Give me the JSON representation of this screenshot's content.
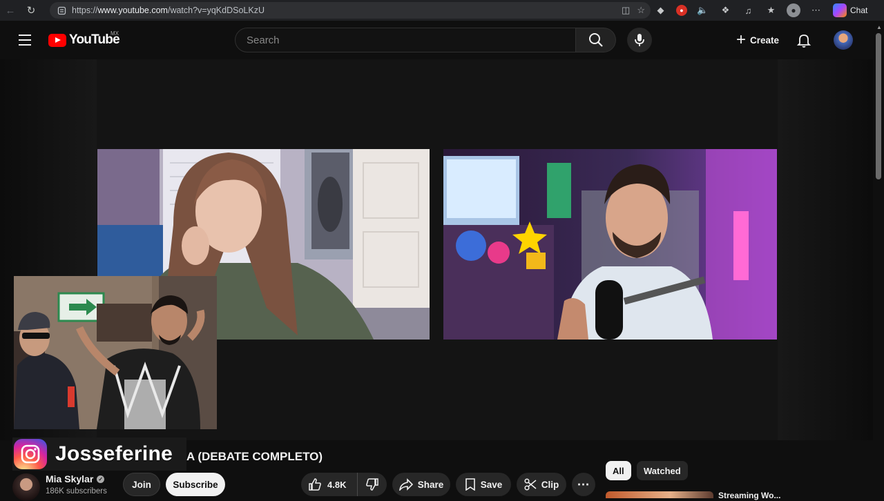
{
  "browser": {
    "url_prefix": "https://",
    "url_domain": "www.youtube.com",
    "url_path": "/watch?v=yqKdDSoLKzU",
    "chat_label": "Chat"
  },
  "header": {
    "logo_text": "YouTube",
    "region": "MX",
    "search_placeholder": "Search",
    "create_label": "Create"
  },
  "video": {
    "title_visible": "A (DEBATE COMPLETO)",
    "overlay_handle": "Josseferine"
  },
  "channel": {
    "name": "Mia Skylar",
    "subscribers": "186K subscribers",
    "join_label": "Join",
    "subscribe_label": "Subscribe"
  },
  "actions": {
    "likes": "4.8K",
    "share_label": "Share",
    "save_label": "Save",
    "clip_label": "Clip"
  },
  "chips": {
    "all": "All",
    "watched": "Watched"
  },
  "up_next": {
    "title_partial": "Streaming Wo..."
  }
}
